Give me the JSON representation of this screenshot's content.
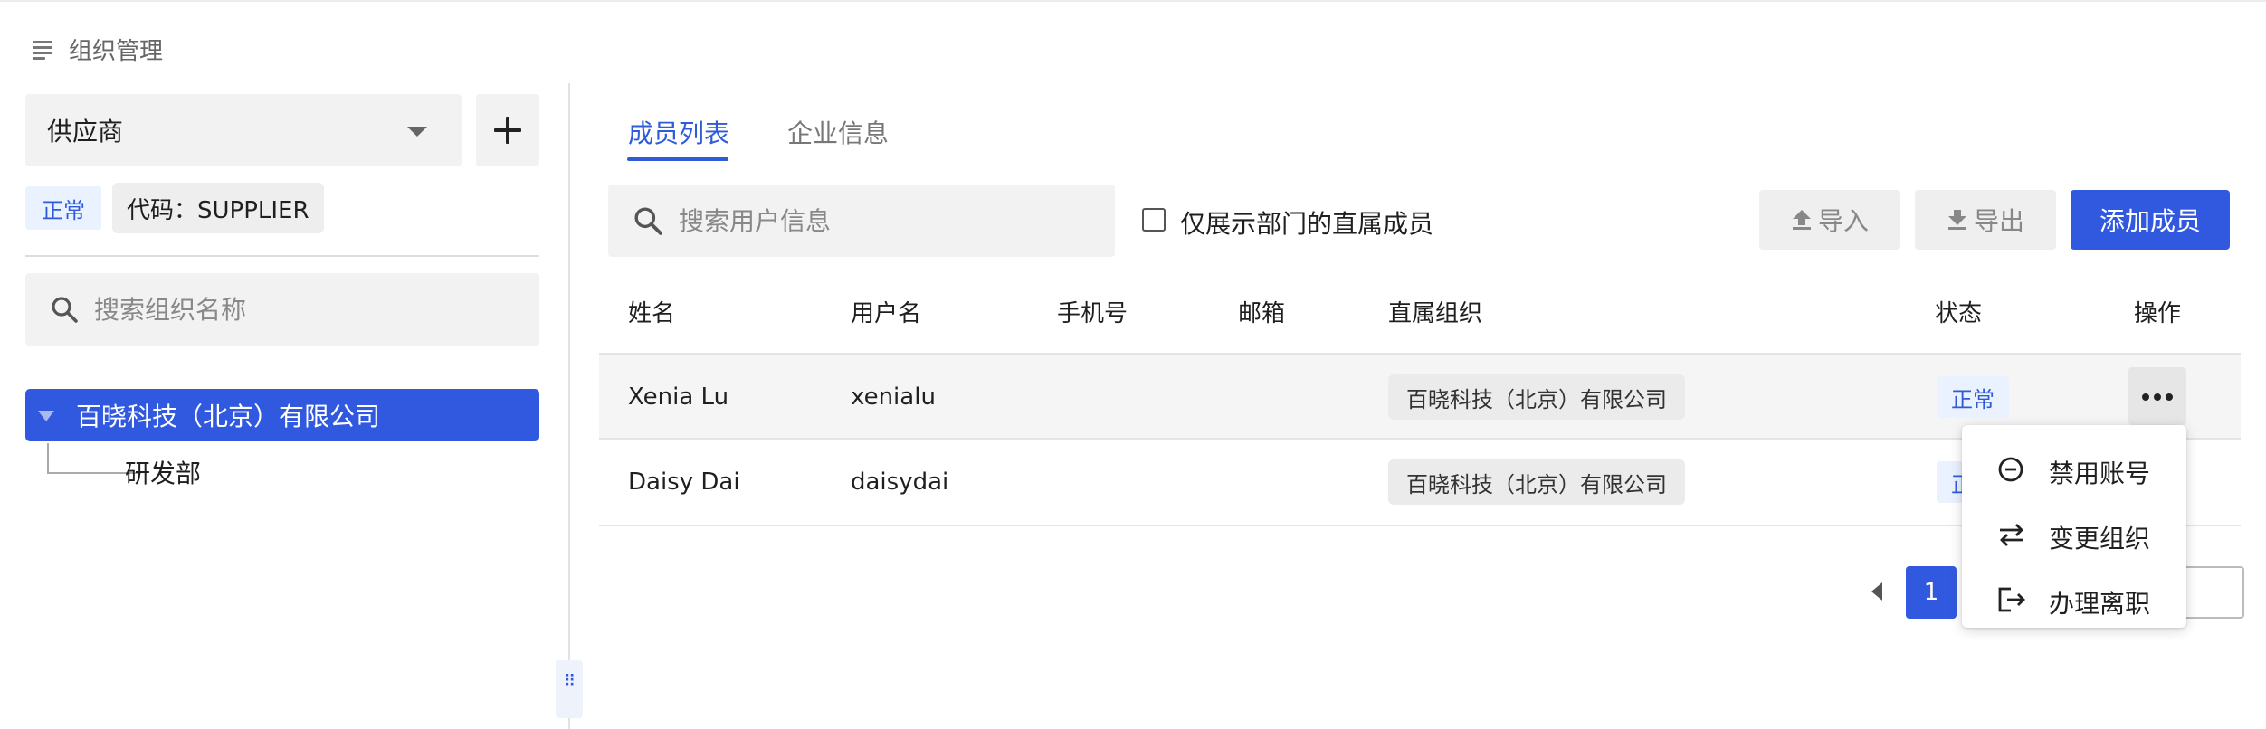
{
  "header": {
    "title": "组织管理",
    "menu_icon": "menu-icon"
  },
  "left_panel": {
    "org_select_value": "供应商",
    "status_badge": "正常",
    "code_badge": "代码：SUPPLIER",
    "search_placeholder": "搜索组织名称",
    "tree": {
      "root_label": "百晓科技（北京）有限公司",
      "children": [
        "研发部"
      ]
    }
  },
  "tabs": [
    {
      "label": "成员列表",
      "active": true
    },
    {
      "label": "企业信息",
      "active": false
    }
  ],
  "toolbar": {
    "search_placeholder": "搜索用户信息",
    "direct_members_label": "仅展示部门的直属成员",
    "direct_members_checked": false,
    "import_label": "导入",
    "export_label": "导出",
    "add_member_label": "添加成员"
  },
  "table": {
    "headers": [
      "姓名",
      "用户名",
      "手机号",
      "邮箱",
      "直属组织",
      "状态",
      "操作"
    ],
    "rows": [
      {
        "name": "Xenia Lu",
        "username": "xenialu",
        "phone": "",
        "email": "",
        "org": "百晓科技（北京）有限公司",
        "status": "正常"
      },
      {
        "name": "Daisy Dai",
        "username": "daisydai",
        "phone": "",
        "email": "",
        "org": "百晓科技（北京）有限公司",
        "status": "正常"
      }
    ]
  },
  "pagination": {
    "current_page": "1"
  },
  "action_menu": {
    "items": [
      {
        "label": "禁用账号",
        "icon": "minus-circle-icon"
      },
      {
        "label": "变更组织",
        "icon": "swap-icon"
      },
      {
        "label": "办理离职",
        "icon": "logout-icon"
      }
    ]
  },
  "colors": {
    "primary": "#3159df",
    "status_text": "#2f5bd8",
    "status_bg": "#eaf1ff"
  }
}
